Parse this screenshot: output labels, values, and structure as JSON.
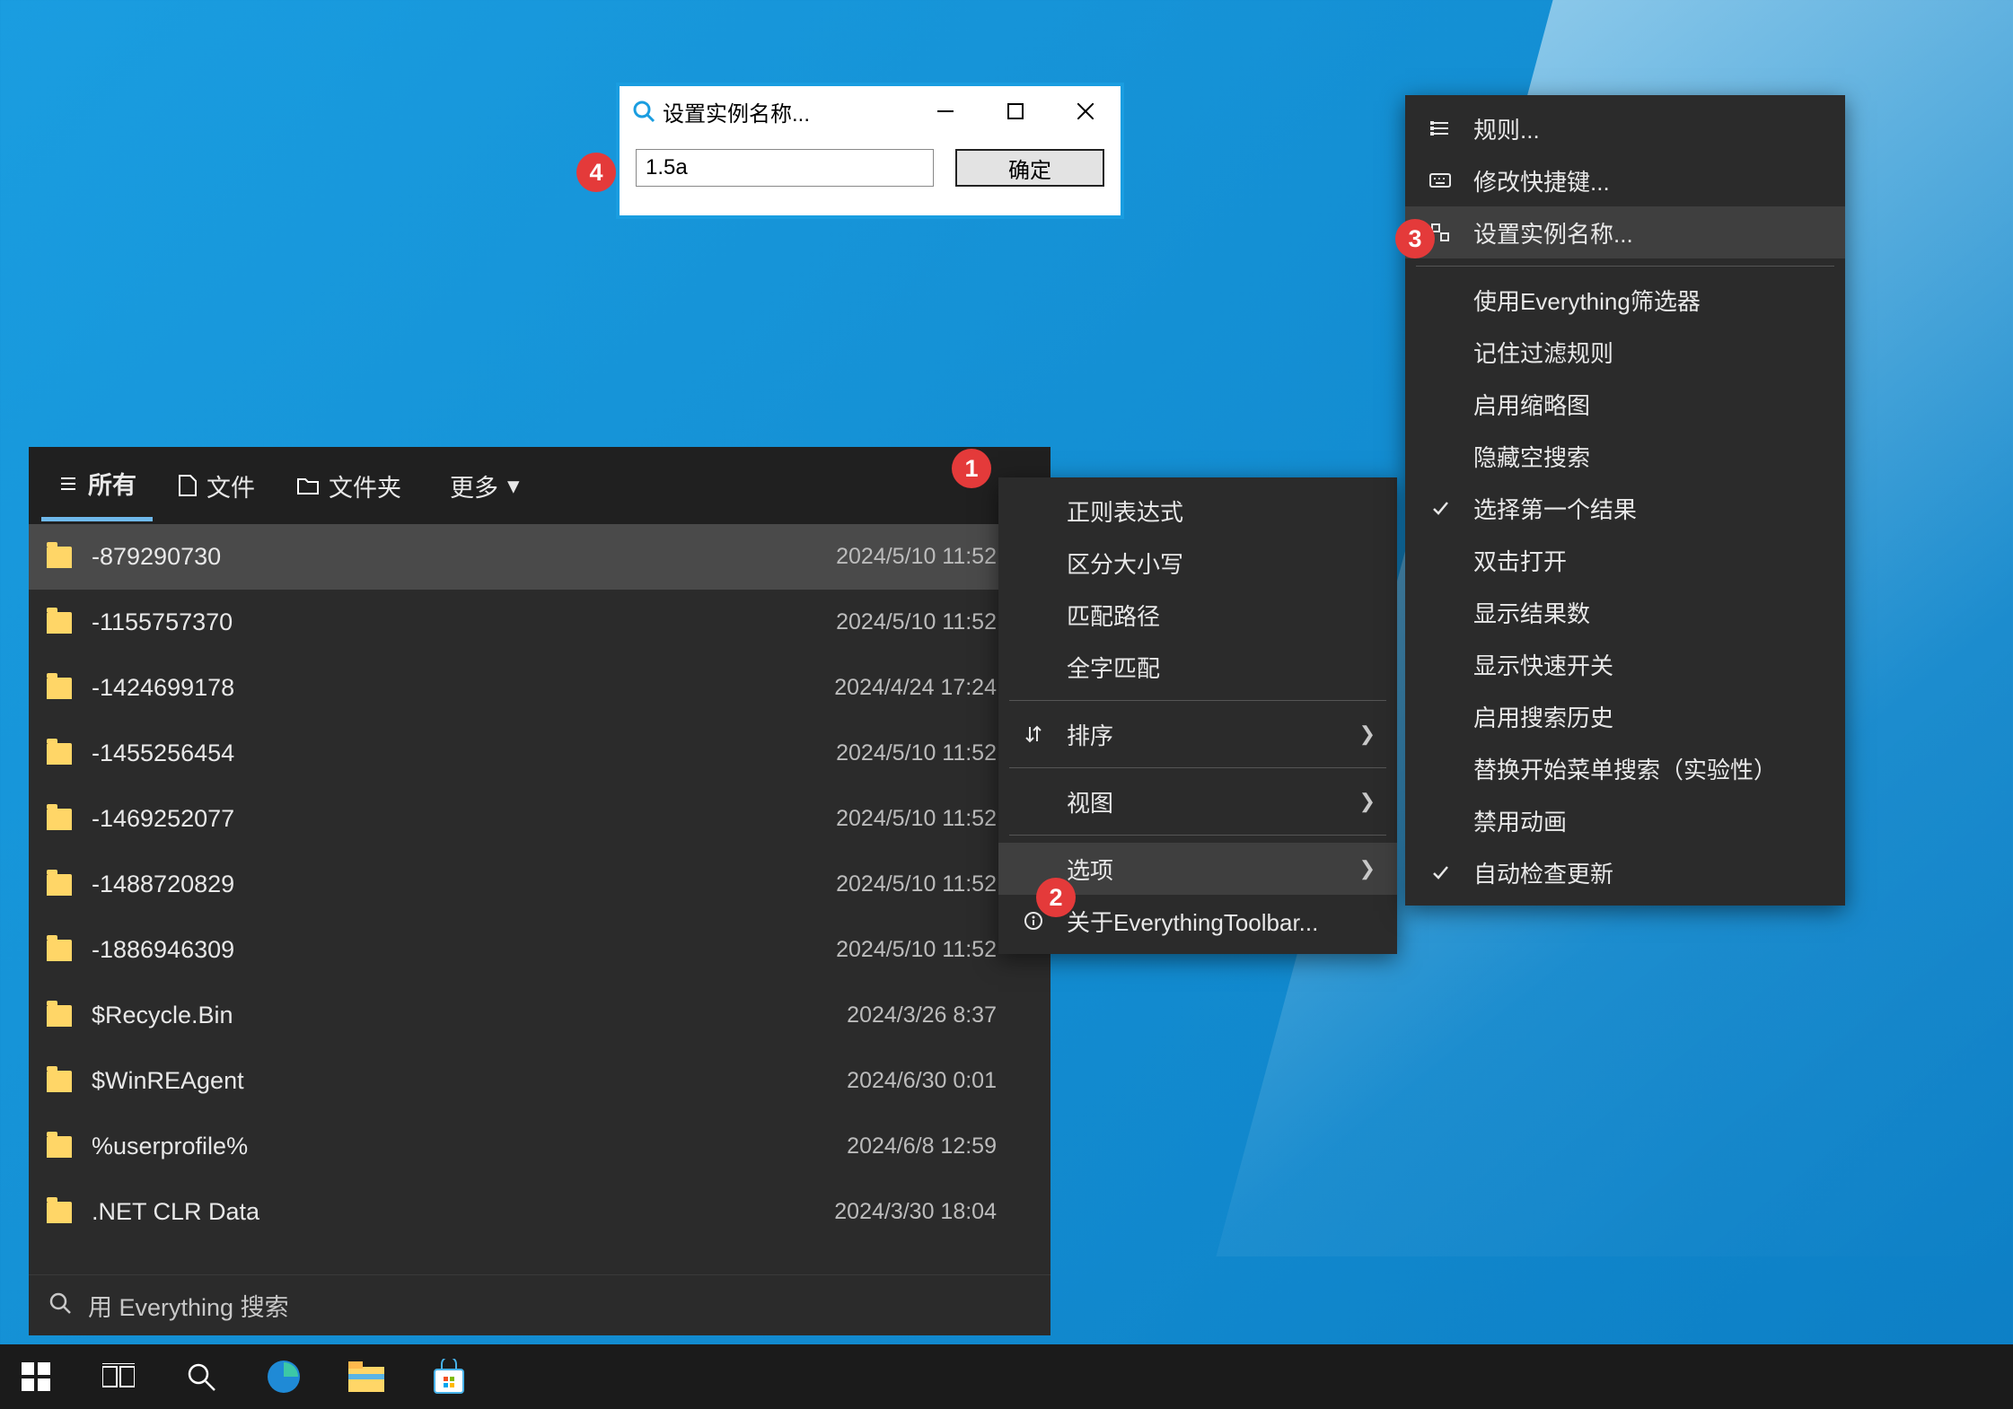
{
  "dialog": {
    "title": "设置实例名称...",
    "input_value": "1.5a",
    "ok_label": "确定"
  },
  "results": {
    "tabs": [
      {
        "label": "所有",
        "icon": "list-icon",
        "active": true
      },
      {
        "label": "文件",
        "icon": "file-icon",
        "active": false
      },
      {
        "label": "文件夹",
        "icon": "folder-outline-icon",
        "active": false
      }
    ],
    "more_label": "更多",
    "rows": [
      {
        "name": "-879290730",
        "date": "2024/5/10 11:52",
        "selected": true
      },
      {
        "name": "-1155757370",
        "date": "2024/5/10 11:52",
        "selected": false
      },
      {
        "name": "-1424699178",
        "date": "2024/4/24 17:24",
        "selected": false
      },
      {
        "name": "-1455256454",
        "date": "2024/5/10 11:52",
        "selected": false
      },
      {
        "name": "-1469252077",
        "date": "2024/5/10 11:52",
        "selected": false
      },
      {
        "name": "-1488720829",
        "date": "2024/5/10 11:52",
        "selected": false
      },
      {
        "name": "-1886946309",
        "date": "2024/5/10 11:52",
        "selected": false
      },
      {
        "name": "$Recycle.Bin",
        "date": "2024/3/26 8:37",
        "selected": false
      },
      {
        "name": "$WinREAgent",
        "date": "2024/6/30 0:01",
        "selected": false
      },
      {
        "name": "%userprofile%",
        "date": "2024/6/8 12:59",
        "selected": false
      },
      {
        "name": ".NET CLR Data",
        "date": "2024/3/30 18:04",
        "selected": false
      }
    ],
    "search_placeholder": "用 Everything 搜索"
  },
  "ctx1": {
    "items": [
      {
        "label": "正则表达式",
        "type": "item"
      },
      {
        "label": "区分大小写",
        "type": "item"
      },
      {
        "label": "匹配路径",
        "type": "item"
      },
      {
        "label": "全字匹配",
        "type": "item"
      },
      {
        "type": "sep"
      },
      {
        "label": "排序",
        "type": "submenu",
        "icon": "sort-icon"
      },
      {
        "type": "sep"
      },
      {
        "label": "视图",
        "type": "submenu"
      },
      {
        "type": "sep"
      },
      {
        "label": "选项",
        "type": "submenu",
        "hover": true
      },
      {
        "label": "关于EverythingToolbar...",
        "type": "item",
        "icon": "info-icon"
      }
    ]
  },
  "ctx2": {
    "items": [
      {
        "label": "规则...",
        "type": "item",
        "icon": "rules-icon"
      },
      {
        "label": "修改快捷键...",
        "type": "item",
        "icon": "keyboard-icon"
      },
      {
        "label": "设置实例名称...",
        "type": "item",
        "icon": "resize-icon",
        "hover": true
      },
      {
        "type": "sep"
      },
      {
        "label": "使用Everything筛选器",
        "type": "item"
      },
      {
        "label": "记住过滤规则",
        "type": "item"
      },
      {
        "label": "启用缩略图",
        "type": "item"
      },
      {
        "label": "隐藏空搜索",
        "type": "item"
      },
      {
        "label": "选择第一个结果",
        "type": "item",
        "checked": true
      },
      {
        "label": "双击打开",
        "type": "item"
      },
      {
        "label": "显示结果数",
        "type": "item"
      },
      {
        "label": "显示快速开关",
        "type": "item"
      },
      {
        "label": "启用搜索历史",
        "type": "item"
      },
      {
        "label": "替换开始菜单搜索（实验性）",
        "type": "item"
      },
      {
        "label": "禁用动画",
        "type": "item"
      },
      {
        "label": "自动检查更新",
        "type": "item",
        "checked": true
      }
    ]
  },
  "badges": {
    "b1": "1",
    "b2": "2",
    "b3": "3",
    "b4": "4"
  }
}
